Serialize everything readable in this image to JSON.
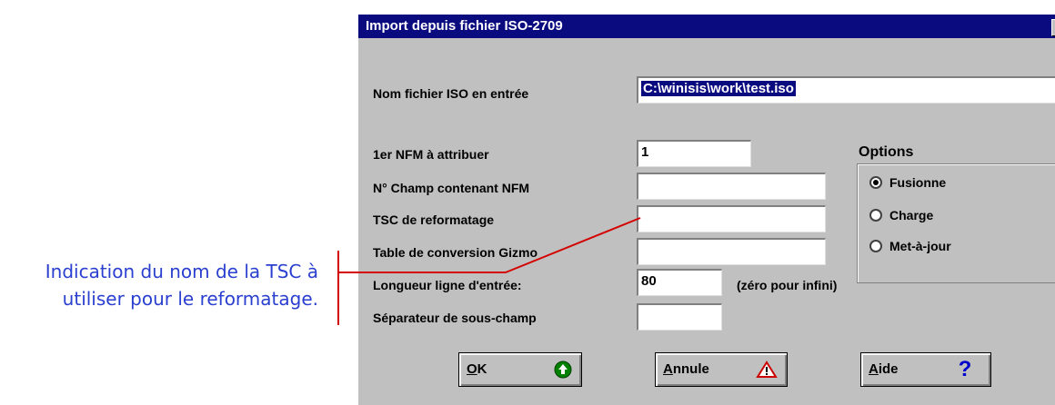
{
  "annotation": {
    "line1": "Indication du nom de la TSC à",
    "line2": "utiliser pour le reformatage."
  },
  "dialog": {
    "title": "Import depuis fichier ISO-2709",
    "close_glyph": "✕",
    "fields": {
      "iso_file_label": "Nom fichier ISO en entrée",
      "iso_file_value": "C:\\winisis\\work\\test.iso",
      "first_mfn_label": "1er NFM à attribuer",
      "first_mfn_value": "1",
      "field_mfn_label": "N° Champ contenant NFM",
      "field_mfn_value": "",
      "tsc_label": "TSC de reformatage",
      "tsc_value": "",
      "gizmo_label": "Table de conversion Gizmo",
      "gizmo_value": "",
      "line_length_label": "Longueur ligne d'entrée:",
      "line_length_value": "80",
      "line_length_hint": "(zéro pour infini)",
      "subfield_sep_label": "Séparateur de sous-champ",
      "subfield_sep_value": ""
    },
    "options": {
      "title": "Options",
      "items": [
        {
          "label": "Fusionne",
          "checked": true
        },
        {
          "label": "Charge",
          "checked": false
        },
        {
          "label": "Met-à-jour",
          "checked": false
        }
      ]
    },
    "buttons": {
      "ok": {
        "mnemonic": "O",
        "rest": "K",
        "icon": "green-up-arrow-icon",
        "color": "#008000"
      },
      "cancel": {
        "mnemonic": "A",
        "rest": "nnule",
        "icon": "warning-triangle-icon",
        "color": "#cc0000"
      },
      "help": {
        "mnemonic": "A",
        "rest": "ide",
        "icon": "question-mark-icon",
        "color": "#0000cc"
      }
    }
  },
  "colors": {
    "titlebar": "#0b0b80",
    "dialog_bg": "#c0c0c0",
    "annotation_text": "#2a3fcf",
    "callout_line": "#d40000"
  }
}
